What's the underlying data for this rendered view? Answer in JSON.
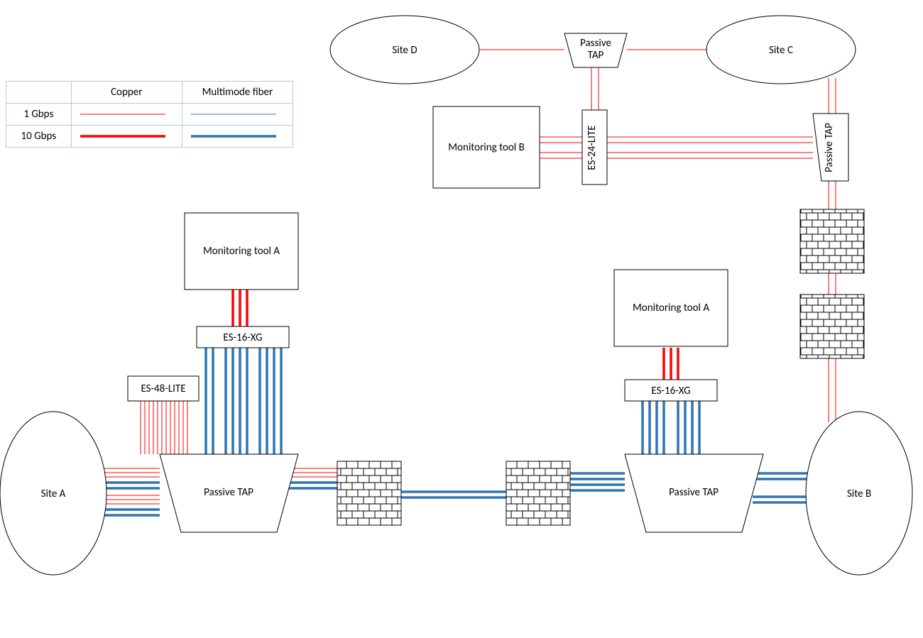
{
  "legend": {
    "col1": "Copper",
    "col2": "Multimode fiber",
    "row1": "1 Gbps",
    "row2": "10 Gbps",
    "colors": {
      "copper": "#ff0000",
      "fiber": "#2e75b6"
    }
  },
  "nodes": {
    "siteA": "Site A",
    "siteB": "Site B",
    "siteC": "Site C",
    "siteD": "Site D",
    "monA_left": "Monitoring tool A",
    "monA_right": "Monitoring tool A",
    "monB": "Monitoring tool B",
    "es16_left": "ES-16-XG",
    "es16_right": "ES-16-XG",
    "es48": "ES-48-LITE",
    "es24": "ES-24-LITE",
    "tap_left": "Passive TAP",
    "tap_right": "Passive TAP",
    "tap_top": "Passive TAP",
    "tap_side": "Passive TAP"
  }
}
